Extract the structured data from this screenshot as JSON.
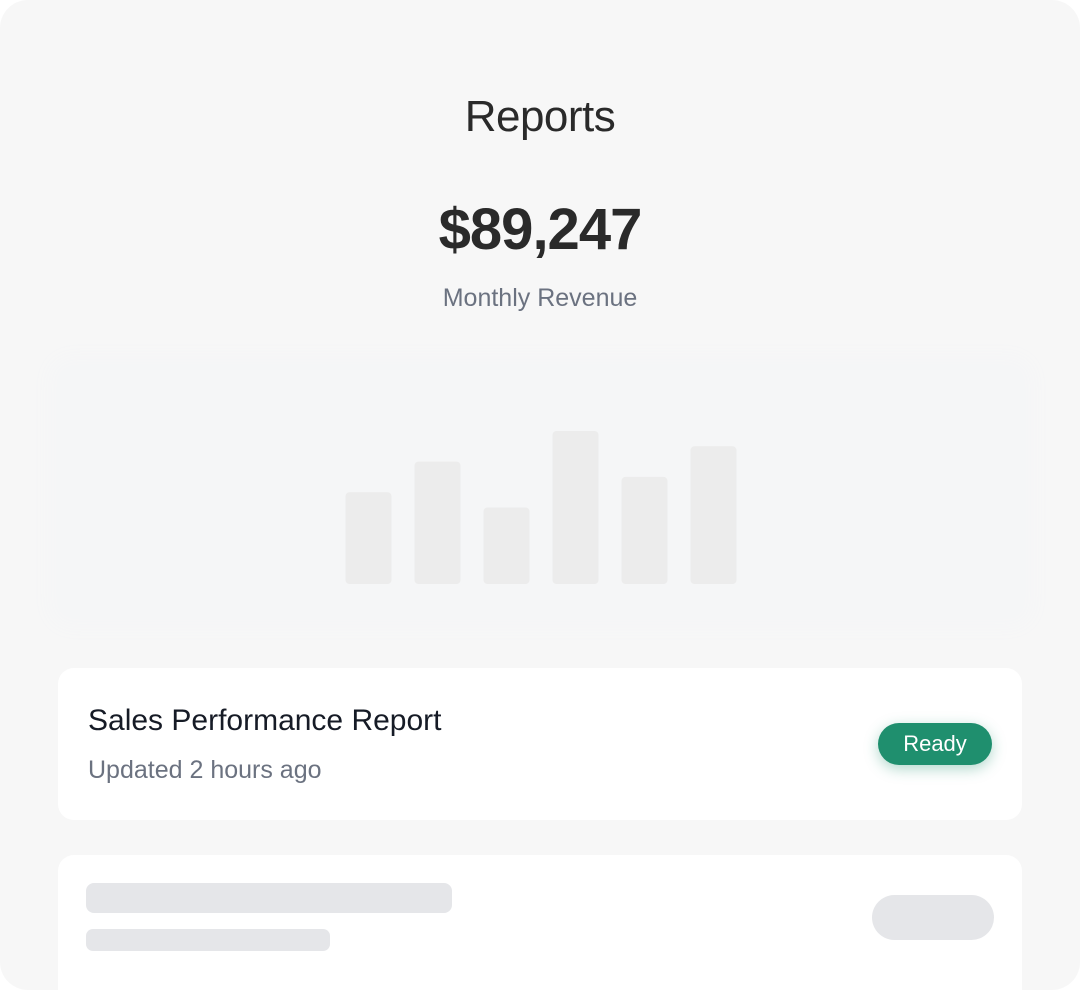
{
  "header": {
    "title": "Reports"
  },
  "metric": {
    "value": "$89,247",
    "label": "Monthly Revenue"
  },
  "chart_data": {
    "type": "bar",
    "categories": [
      "",
      "",
      "",
      "",
      "",
      ""
    ],
    "values": [
      60,
      80,
      50,
      100,
      70,
      90
    ],
    "ylim": [
      0,
      100
    ],
    "grid": false,
    "bar_color": "#ececec"
  },
  "reports": [
    {
      "title": "Sales Performance Report",
      "subtitle": "Updated 2 hours ago",
      "status": "Ready",
      "status_color": "#1f8f6e"
    }
  ],
  "colors": {
    "background": "#f7f7f7",
    "card": "#ffffff",
    "text_primary": "#2a2a2a",
    "text_secondary": "#6b7280",
    "skeleton": "#e5e6e9"
  }
}
